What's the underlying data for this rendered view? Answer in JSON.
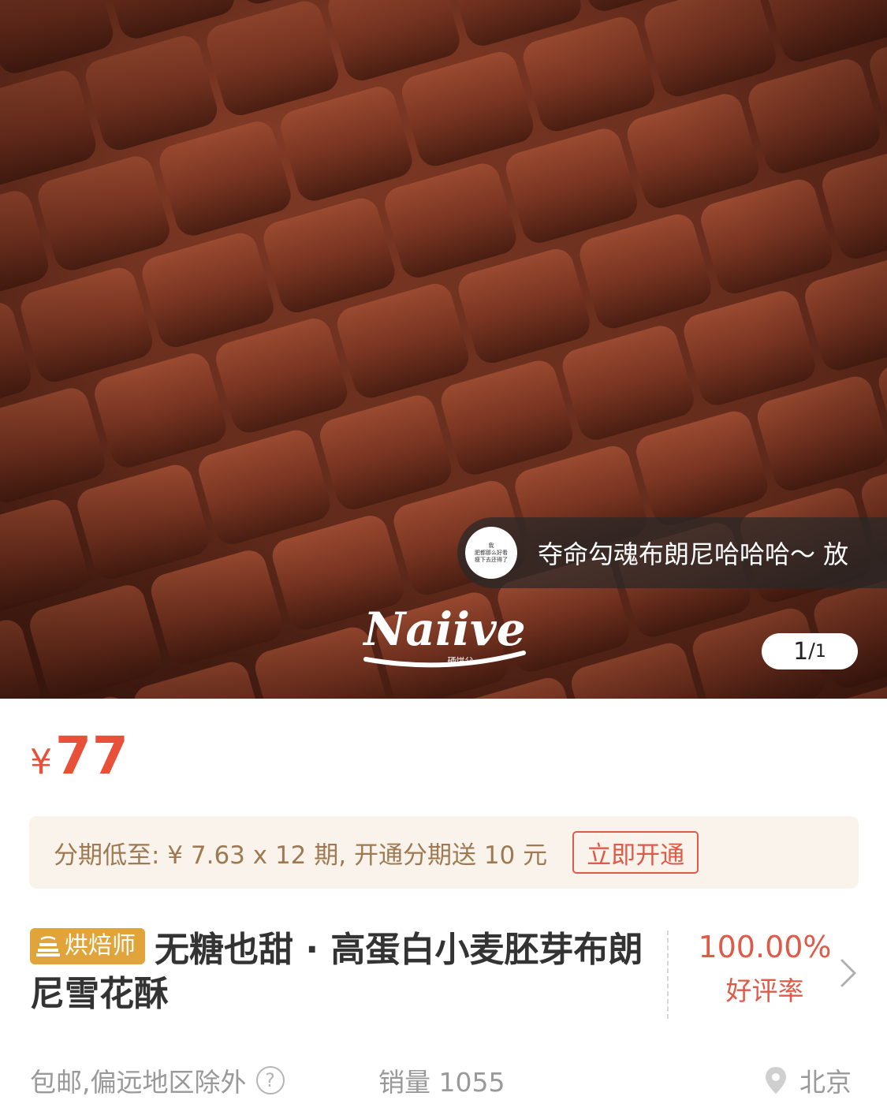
{
  "hero": {
    "logo_text": "Naiive",
    "logo_subtext": "硒饼父",
    "comment": {
      "avatar_lines": [
        "我",
        "肥都那么好看",
        "瘦下去还得了"
      ],
      "text": "夺命勾魂布朗尼哈哈哈～  放"
    },
    "pager": {
      "current": "1",
      "separator": "/",
      "total": "1"
    }
  },
  "price": {
    "symbol": "¥",
    "value": "77"
  },
  "installment": {
    "text": "分期低至: ¥ 7.63 x 12 期, 开通分期送 10 元",
    "button_label": "立即开通"
  },
  "product": {
    "badge": "烘焙师",
    "title": "无糖也甜 · 高蛋白小麦胚芽布朗尼雪花酥"
  },
  "rating": {
    "percent": "100.00%",
    "label": "好评率"
  },
  "meta": {
    "shipping": "包邮,偏远地区除外",
    "help_symbol": "?",
    "sales": "销量 1055",
    "location": "北京"
  },
  "colors": {
    "price_red": "#e8503a",
    "badge_gold": "#e1a43a",
    "installment_bg": "#faf3ec",
    "installment_text": "#9e7a52"
  }
}
